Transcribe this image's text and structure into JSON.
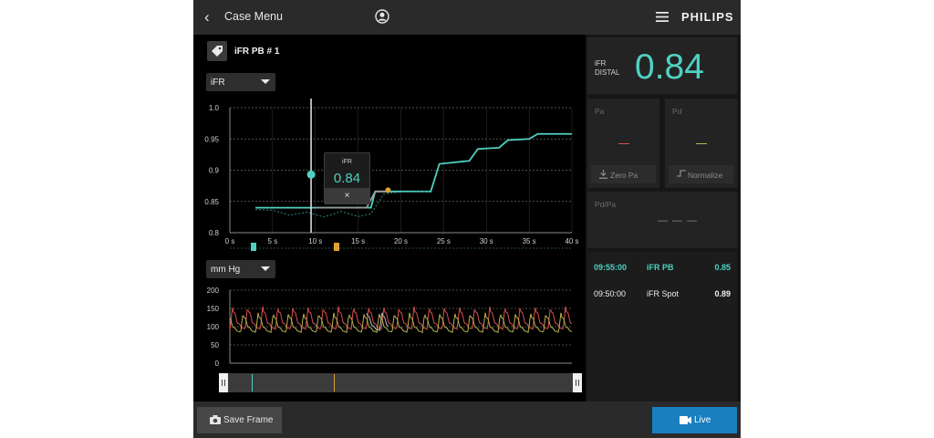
{
  "header": {
    "back_label": "Case Menu",
    "brand": "PHILIPS"
  },
  "left": {
    "record_title": "iFR PB # 1",
    "metric_select": "iFR",
    "unit_select": "mm Hg",
    "tooltip": {
      "label": "iFR",
      "value": "0.84",
      "close": "×"
    }
  },
  "right": {
    "ifr_label": "iFR DISTAL",
    "ifr_value": "0.84",
    "pa_label": "Pa",
    "pd_label": "Pd",
    "zero_pa": "Zero Pa",
    "normalize": "Normalize",
    "pdpa_label": "Pd/Pa",
    "pdpa_value": "— — —",
    "rows": [
      {
        "time": "09:55:00",
        "name": "iFR PB",
        "value": "0.85"
      },
      {
        "time": "09:50:00",
        "name": "iFR Spot",
        "value": "0.89"
      }
    ]
  },
  "footer": {
    "save_label": "Save Frame",
    "live_label": "Live"
  },
  "colors": {
    "teal": "#4fd1c1",
    "orange": "#e0a030",
    "red": "#d94f4f",
    "olive": "#b7b24a",
    "live_blue": "#1a7fbf"
  },
  "chart_data": [
    {
      "type": "line",
      "title": "",
      "xlabel": "",
      "ylabel": "",
      "xlim": [
        0,
        40
      ],
      "ylim": [
        0.8,
        1.0
      ],
      "x_ticks": [
        "0 s",
        "5 s",
        "10 s",
        "15 s",
        "20 s",
        "25 s",
        "30 s",
        "35 s",
        "40 s"
      ],
      "y_ticks": [
        "0.8",
        "0.85",
        "0.9",
        "0.95",
        "1.0"
      ],
      "cursor_x": 9.5,
      "series": [
        {
          "color": "#4fd1c1",
          "points": [
            [
              3,
              0.84
            ],
            [
              16.5,
              0.84
            ],
            [
              17,
              0.866
            ],
            [
              23.5,
              0.866
            ],
            [
              24.5,
              0.91
            ],
            [
              28,
              0.915
            ],
            [
              29,
              0.934
            ],
            [
              31.5,
              0.936
            ],
            [
              32.5,
              0.948
            ],
            [
              35,
              0.95
            ],
            [
              36,
              0.958
            ],
            [
              40,
              0.958
            ]
          ]
        },
        {
          "color": "#2d8a80",
          "dashed": true,
          "points": [
            [
              3,
              0.837
            ],
            [
              5,
              0.836
            ],
            [
              7,
              0.828
            ],
            [
              9,
              0.833
            ],
            [
              11,
              0.825
            ],
            [
              13,
              0.834
            ],
            [
              15,
              0.826
            ],
            [
              16.5,
              0.83
            ],
            [
              18,
              0.862
            ],
            [
              20,
              0.865
            ],
            [
              23.5,
              0.866
            ]
          ]
        },
        {
          "color": "#9a9a9a",
          "points": [
            [
              10,
              0.84
            ],
            [
              16,
              0.84
            ],
            [
              17,
              0.866
            ],
            [
              18.5,
              0.866
            ]
          ]
        }
      ],
      "points": [
        {
          "x": 9.5,
          "y": 0.893,
          "color": "#4fd1c1"
        },
        {
          "x": 18.5,
          "y": 0.868,
          "color": "#e0a030"
        }
      ]
    },
    {
      "type": "line",
      "title": "",
      "xlabel": "",
      "ylabel": "",
      "xlim": [
        0,
        40
      ],
      "ylim": [
        0,
        200
      ],
      "y_ticks": [
        "0",
        "50",
        "100",
        "150",
        "200"
      ],
      "series": [
        {
          "name": "Pa",
          "color": "#d94f4f",
          "points": []
        },
        {
          "name": "Pd",
          "color": "#b7b24a",
          "points": []
        }
      ]
    }
  ]
}
